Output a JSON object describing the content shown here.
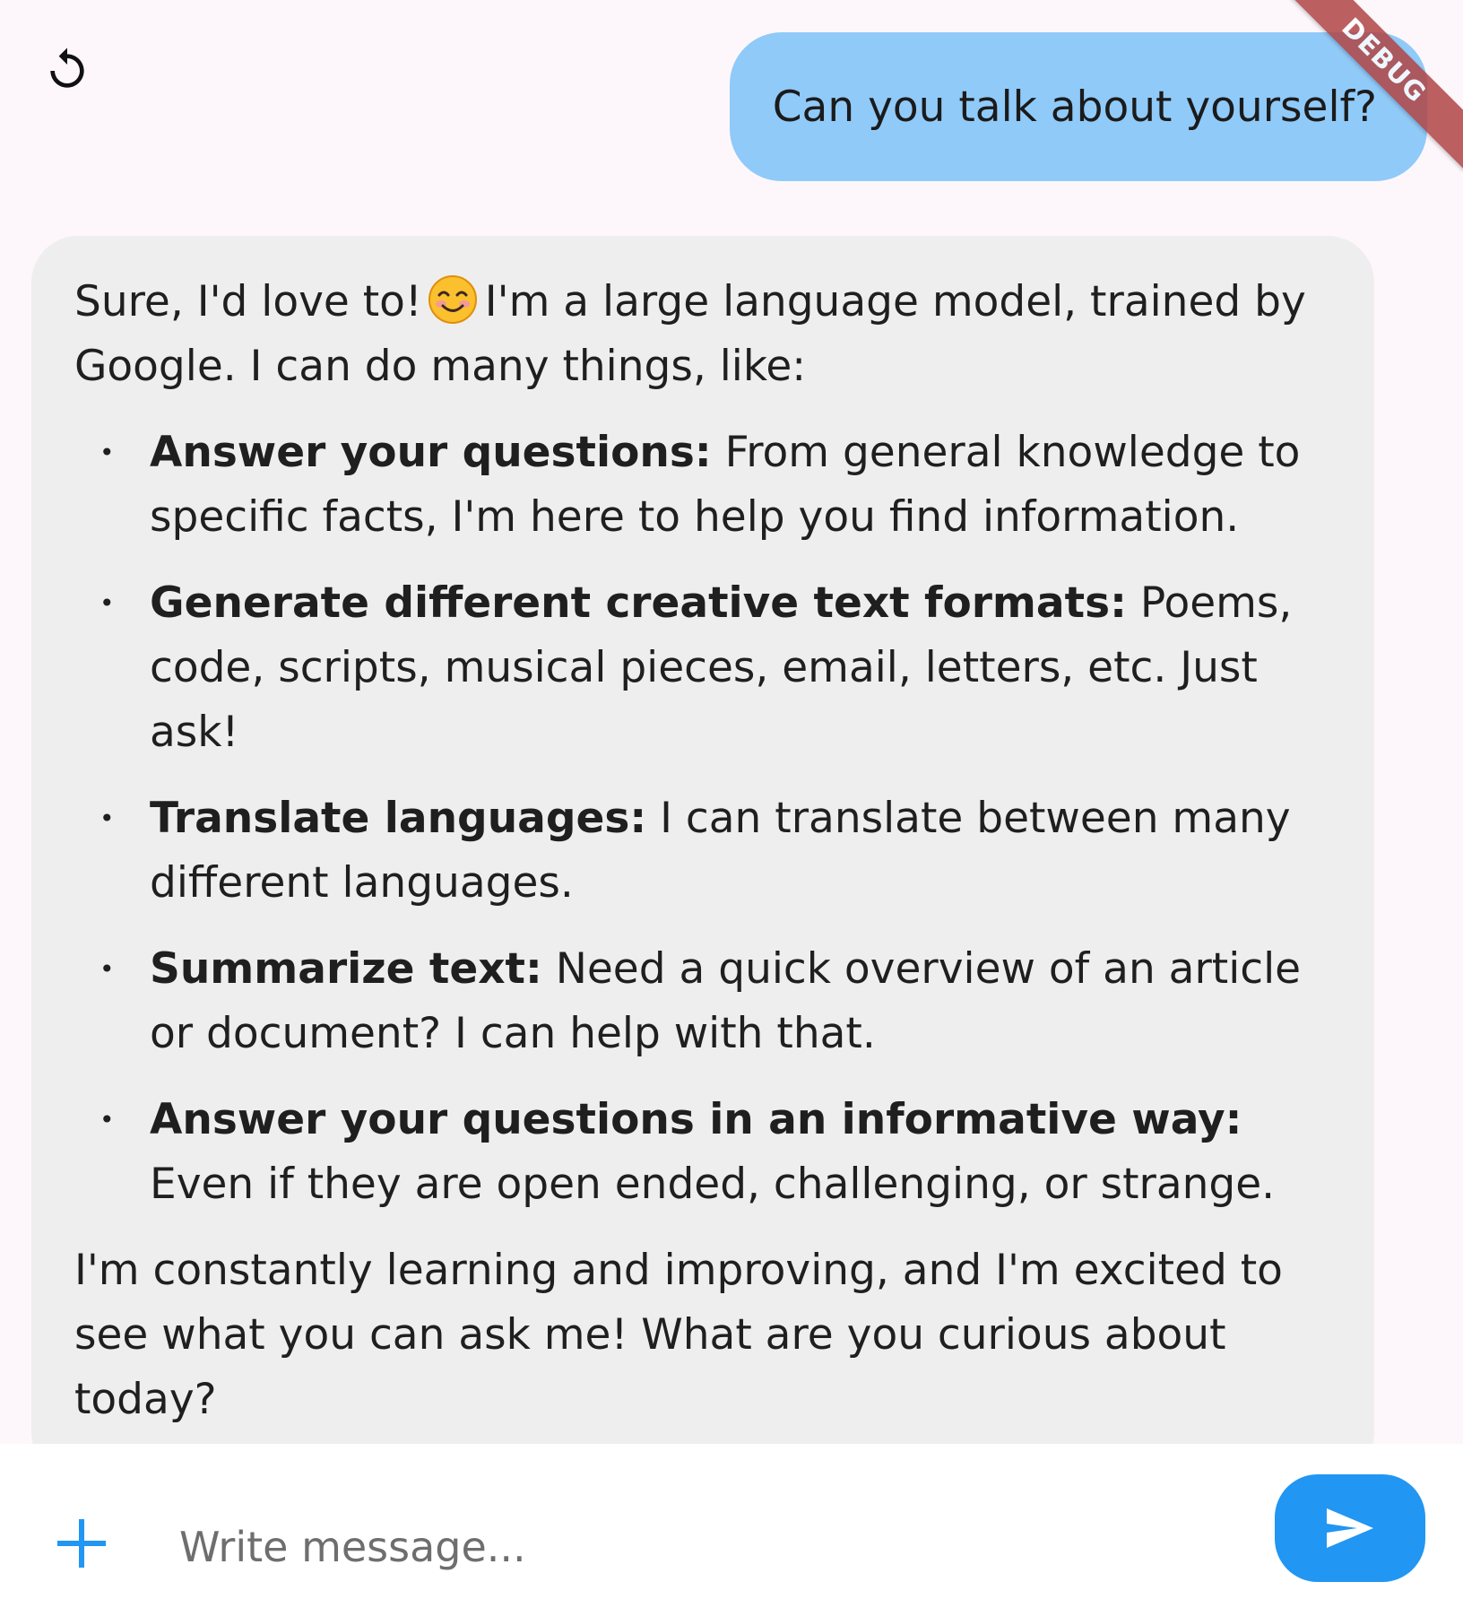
{
  "colors": {
    "background": "#fdf7fc",
    "user_bubble": "#90caf9",
    "bot_bubble": "#eeeeee",
    "send_button": "#2196f3",
    "plus_icon": "#2196f3",
    "debug_banner": "#b04545"
  },
  "header": {
    "reset_icon": "refresh-icon"
  },
  "debug_banner": "DEBUG",
  "messages": {
    "user": {
      "text": "Can you talk about yourself?"
    },
    "bot": {
      "intro_part1": "Sure, I'd love to!",
      "intro_emoji": "smiling-face-icon",
      "intro_part2": "I'm a large language model, trained by Google. I can do many things, like:",
      "items": [
        {
          "title": "Answer your questions:",
          "text": " From general knowledge to specific facts, I'm here to help you find information."
        },
        {
          "title": "Generate different creative text formats:",
          "text": "Poems, code, scripts, musical pieces, email, letters, etc.  Just ask!"
        },
        {
          "title": "Translate languages:",
          "text": "I can translate between many different languages."
        },
        {
          "title": "Summarize text:",
          "text": "Need a quick overview of an article or document? I can help with that."
        },
        {
          "title": "Answer your questions in an informative way:",
          "text": "Even if they are open ended, challenging, or strange."
        }
      ],
      "bullet": "•",
      "closing": "I'm constantly learning and improving, and I'm excited to see what you can ask me!  What are you curious about today?"
    }
  },
  "composer": {
    "placeholder": "Write message...",
    "value": "",
    "attach_icon": "plus-icon",
    "send_icon": "send-icon"
  }
}
